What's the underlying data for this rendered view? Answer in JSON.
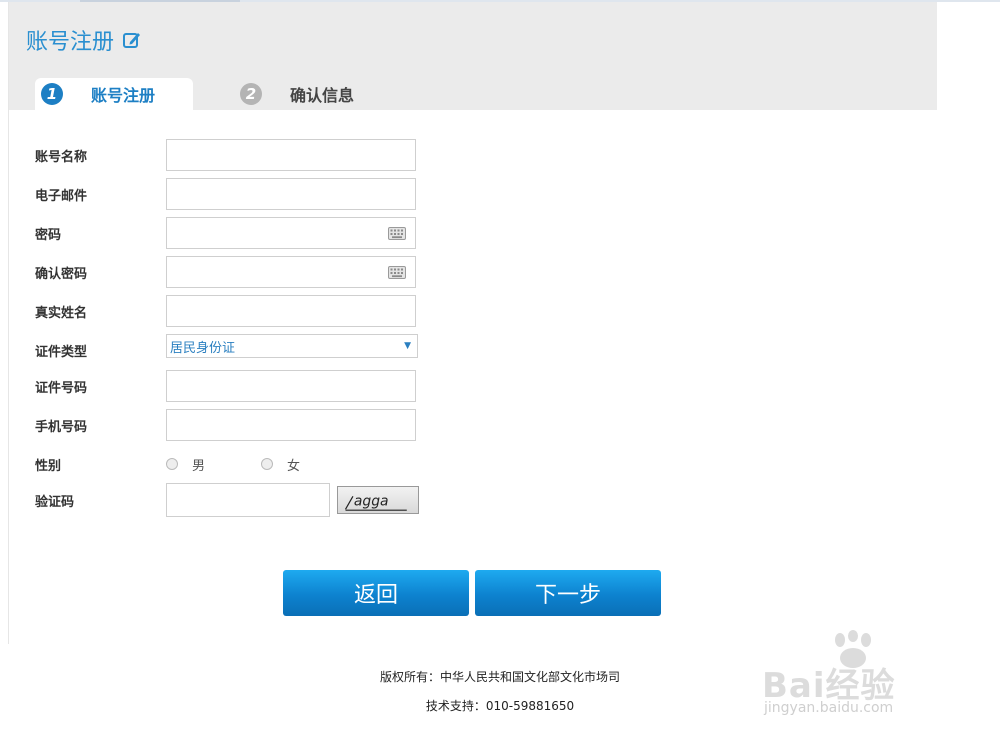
{
  "header": {
    "title": "账号注册"
  },
  "tabs": [
    {
      "num": "1",
      "label": "账号注册"
    },
    {
      "num": "2",
      "label": "确认信息"
    }
  ],
  "form": {
    "account_name": {
      "label": "账号名称",
      "value": ""
    },
    "email": {
      "label": "电子邮件",
      "value": ""
    },
    "password": {
      "label": "密码",
      "value": ""
    },
    "confirm_password": {
      "label": "确认密码",
      "value": ""
    },
    "real_name": {
      "label": "真实姓名",
      "value": ""
    },
    "id_type": {
      "label": "证件类型",
      "selected": "居民身份证"
    },
    "id_number": {
      "label": "证件号码",
      "value": ""
    },
    "phone": {
      "label": "手机号码",
      "value": ""
    },
    "gender": {
      "label": "性别",
      "options": [
        "男",
        "女"
      ]
    },
    "captcha": {
      "label": "验证码",
      "value": "",
      "image_text": "agga"
    }
  },
  "buttons": {
    "back": "返回",
    "next": "下一步"
  },
  "footer": {
    "copyright": "版权所有：中华人民共和国文化部文化市场司",
    "support": "技术支持：010-59881650"
  },
  "watermark": {
    "brand": "Bai经验",
    "url": "jingyan.baidu.com"
  },
  "colors": {
    "accent": "#1d7fc4",
    "title": "#2a8fd0",
    "header_bg": "#ebebeb"
  }
}
